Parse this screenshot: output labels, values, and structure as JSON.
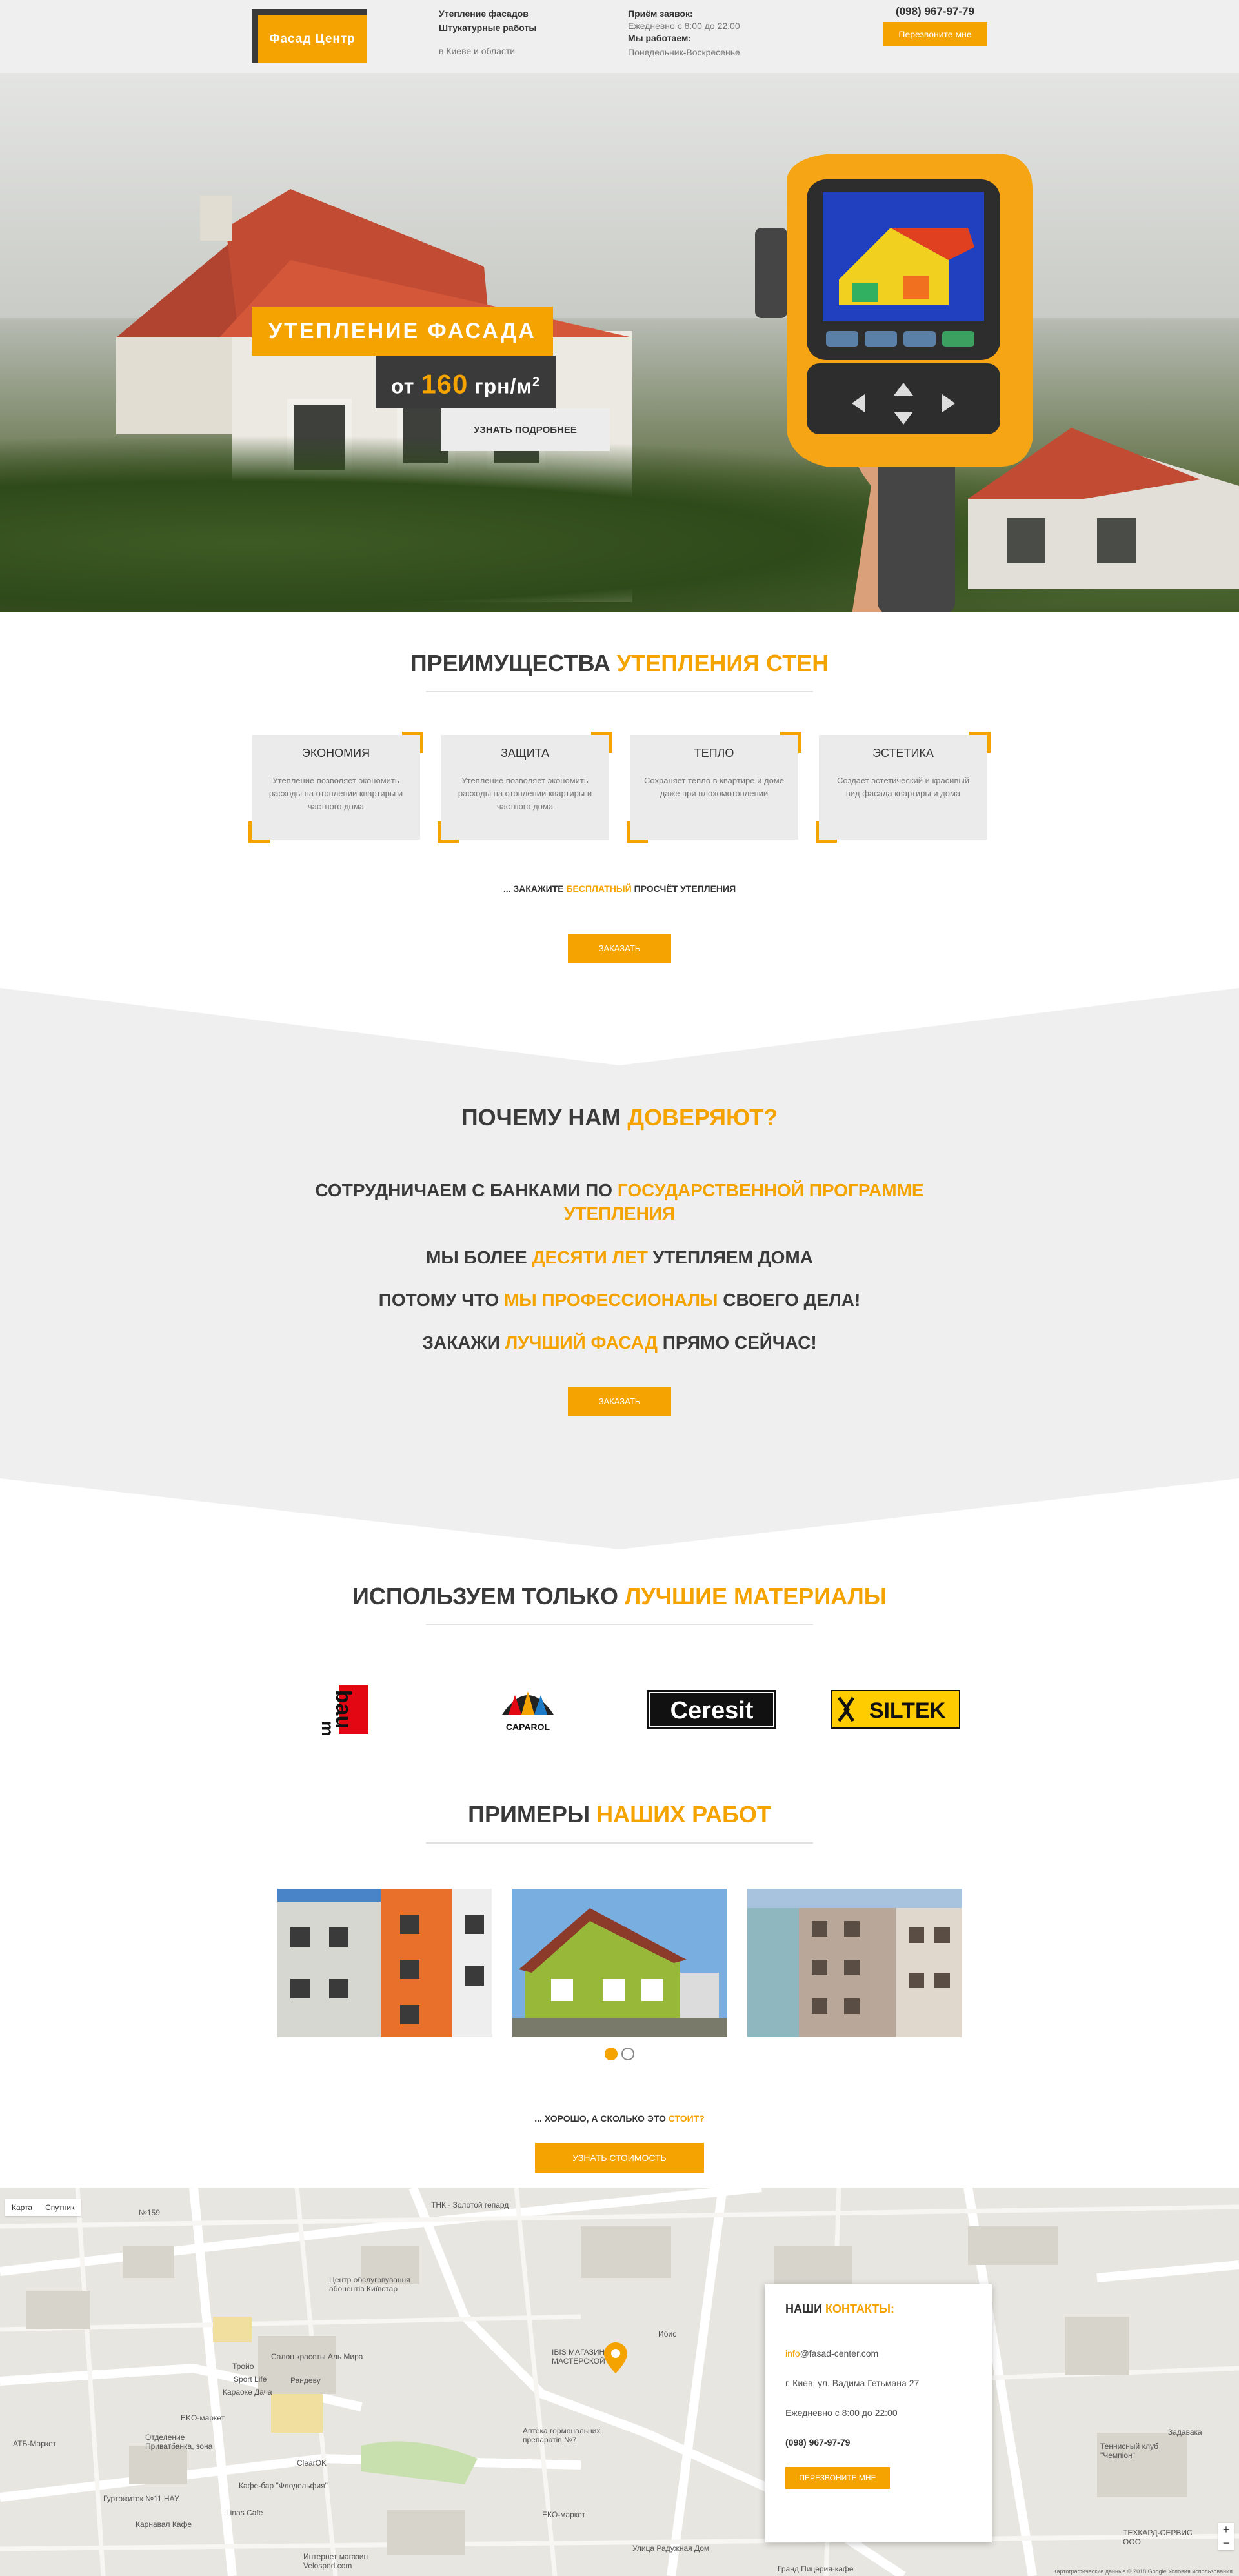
{
  "header": {
    "logo": "Фасад Центр",
    "services": [
      "Утепление фасадов",
      "Штукатурные работы"
    ],
    "region": "в Киеве и области",
    "hours_title": "Приём заявок:",
    "hours_value": "Ежедневно с 8:00 до 22:00",
    "work_title": "Мы работаем:",
    "work_value": "Понедельник-Воскресенье",
    "phone": "(098) 967-97-79",
    "callback": "Перезвоните мне"
  },
  "hero": {
    "title": "утепление фасада",
    "price_prefix": "от",
    "price_value": "160",
    "price_unit": "грн/м",
    "price_sup": "2",
    "more_btn": "Узнать подробнее",
    "slides": 2,
    "active_slide": 2
  },
  "advantages": {
    "title_plain": "Преимущества",
    "title_accent": "утепления стен",
    "cards": [
      {
        "title": "ЭКОНОМИЯ",
        "text": "Утепление позволяет экономить расходы на отоплении квартиры и частного дома"
      },
      {
        "title": "ЗАЩИТА",
        "text": "Утепление позволяет экономить расходы на отоплении квартиры и частного дома"
      },
      {
        "title": "ТЕПЛО",
        "text": "Сохраняет тепло в квартире и доме даже при плохомотоплении"
      },
      {
        "title": "ЭСТЕТИКА",
        "text": "Создает эстетический и красивый вид фасада квартиры и дома"
      }
    ],
    "note_pre": "... ЗАКАЖИТЕ",
    "note_accent": "БЕСПЛАТНЫЙ",
    "note_post": "ПРОСЧЁТ УТЕПЛЕНИЯ",
    "order_btn": "ЗАКАЗАТЬ"
  },
  "trust": {
    "title_plain": "Почему нам",
    "title_accent": "доверяют?",
    "lines": [
      {
        "pre": "Сотрудничаем с банками по",
        "accent": "государственной программе утепления",
        "post": ""
      },
      {
        "pre": "Мы более",
        "accent": "десяти лет",
        "post": "утепляем дома"
      },
      {
        "pre": "Потому что",
        "accent": "мы профессионалы",
        "post": "своего дела!"
      },
      {
        "pre": "Закажи",
        "accent": "лучший фасад",
        "post": "прямо сейчас!"
      }
    ],
    "order_btn": "ЗАКАЗАТЬ"
  },
  "materials": {
    "title_plain": "Используем только",
    "title_accent": "лучшие материалы",
    "brands": [
      {
        "name": "bau mit",
        "icon": "baumit-logo"
      },
      {
        "name": "CAPAROL",
        "icon": "caparol-logo"
      },
      {
        "name": "Ceresit",
        "icon": "ceresit-logo"
      },
      {
        "name": "SILTEK",
        "icon": "siltek-logo"
      }
    ]
  },
  "works": {
    "title_plain": "Примеры",
    "title_accent": "наших работ",
    "photos": [
      "work-photo-highrise-orange",
      "work-photo-green-house",
      "work-photo-tower"
    ],
    "pages": 2,
    "active_page": 1,
    "note_pre": "... ХОРОШО, А СКОЛЬКО ЭТО",
    "note_accent": "СТОИТ?",
    "cost_btn": "УЗНАТЬ СТОИМОСТЬ"
  },
  "map": {
    "map_btn": "Карта",
    "sat_btn": "Спутник",
    "labels": [
      "ТНК - Золотой гепард",
      "Центр обслуговування абонентів Київстар",
      "Ибис",
      "IBIS МАГАЗИН С МАСТЕРСКОЙ",
      "Аптека гормональних препаратів №7",
      "Салон красоты Аль Мира",
      "Sport Life",
      "Караоке Дача",
      "Рандеву",
      "EKO-маркет",
      "Отделение Приватбанка, зона",
      "ATБ-Маркет",
      "ClearOK",
      "Гуртожиток №11 НАУ",
      "Кафе-бар \"Флодельфия\"",
      "Linas Cafe",
      "Карнавал Кафе",
      "Интернет магазин Velosped.com",
      "ЕКО-маркет",
      "Улица Радужная Дом",
      "Гранд Пицерия-кафе",
      "Задавака",
      "Теннисный клуб \"Чемпіон\"",
      "ТЕХКАРД-СЕРВИС ООО",
      "№159",
      "Тройо"
    ],
    "footer": "Картографические данные © 2018 Google   Условия использования",
    "contact_title_plain": "Наши",
    "contact_title_accent": "контакты:",
    "email_accent": "info",
    "email_rest": "@fasad-center.com",
    "address": "г. Киев, ул. Вадима Гетьмана 27",
    "hours": "Ежедневно с 8:00 до 22:00",
    "phone": "(098) 967-97-79",
    "callback": "ПЕРЕЗВОНИТЕ МНЕ"
  },
  "colors": {
    "accent": "#f5a300",
    "dark": "#3a3a3a",
    "panel": "#efefef"
  }
}
